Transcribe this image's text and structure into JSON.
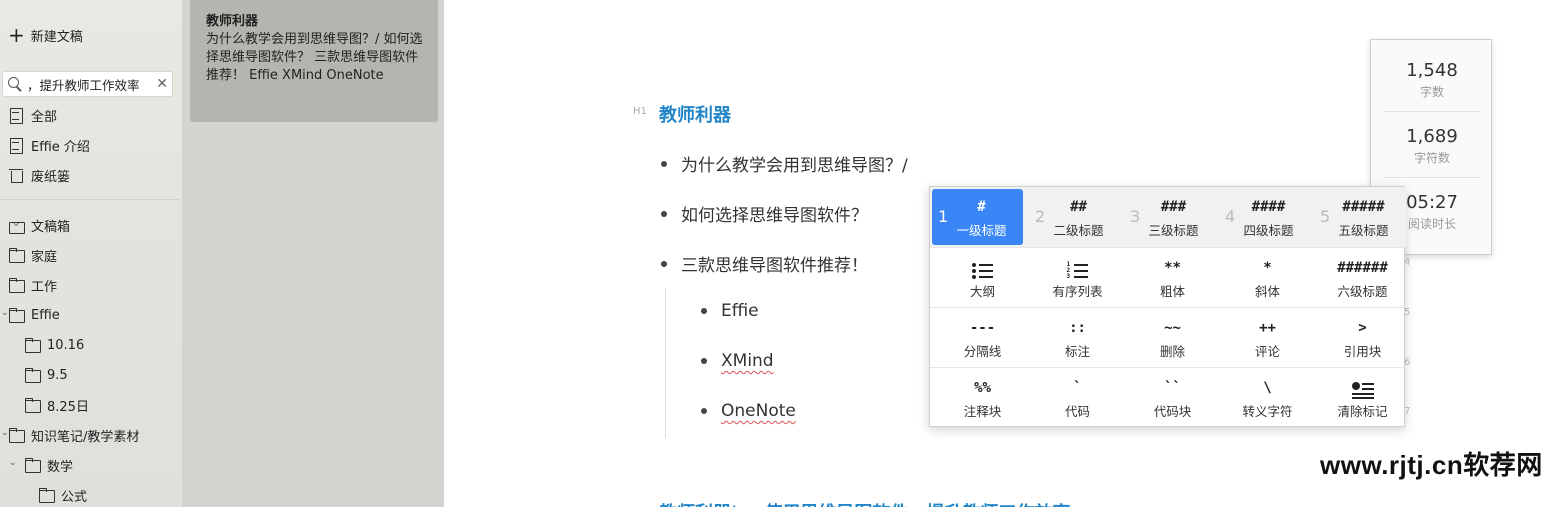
{
  "sidebar": {
    "new_doc_label": "新建文稿",
    "search": {
      "value": "，提升教师工作效率"
    },
    "items": [
      {
        "label": "全部"
      },
      {
        "label": "Effie 介绍"
      },
      {
        "label": "废纸篓"
      },
      {
        "label": "文稿箱"
      },
      {
        "label": "家庭"
      },
      {
        "label": "工作"
      },
      {
        "label": "Effie"
      },
      {
        "label": "10.16"
      },
      {
        "label": "9.5"
      },
      {
        "label": "8.25日"
      },
      {
        "label": "知识笔记/教学素材"
      },
      {
        "label": "数学"
      },
      {
        "label": "公式"
      }
    ]
  },
  "doclist": {
    "selected": {
      "title": "教师利器",
      "preview": "为什么教学会用到思维导图？/ 如何选择思维导图软件？  三款思维导图软件推荐！  Effie XMind OneNote"
    }
  },
  "editor": {
    "heading_tag": "H1",
    "heading": "教师利器",
    "bullets": [
      "为什么教学会用到思维导图？/",
      "如何选择思维导图软件？",
      "三款思维导图软件推荐！"
    ],
    "sub_bullets": [
      "Effie",
      "XMind",
      "OneNote"
    ],
    "line_numbers": [
      "4",
      "5",
      "6",
      "7"
    ],
    "next_heading": "教师利器|... 使用思维导图软件，提升教师工作效率"
  },
  "stats": [
    {
      "value": "1,548",
      "label": "字数"
    },
    {
      "value": "1,689",
      "label": "字符数"
    },
    {
      "value": "05:27",
      "label": "阅读时长"
    }
  ],
  "palette": {
    "rows": [
      [
        {
          "idx": "1",
          "sym": "#",
          "label": "一级标题"
        },
        {
          "idx": "2",
          "sym": "##",
          "label": "二级标题"
        },
        {
          "idx": "3",
          "sym": "###",
          "label": "三级标题"
        },
        {
          "idx": "4",
          "sym": "####",
          "label": "四级标题"
        },
        {
          "idx": "5",
          "sym": "#####",
          "label": "五级标题"
        }
      ],
      [
        {
          "sym": "",
          "icon": "outline-icon",
          "label": "大纲"
        },
        {
          "sym": "",
          "icon": "ordered-list-icon",
          "label": "有序列表"
        },
        {
          "sym": "**",
          "label": "粗体"
        },
        {
          "sym": "*",
          "label": "斜体"
        },
        {
          "sym": "######",
          "label": "六级标题"
        }
      ],
      [
        {
          "sym": "---",
          "label": "分隔线"
        },
        {
          "sym": "::",
          "label": "标注"
        },
        {
          "sym": "~~",
          "label": "删除"
        },
        {
          "sym": "++",
          "label": "评论"
        },
        {
          "sym": ">",
          "label": "引用块"
        }
      ],
      [
        {
          "sym": "%%",
          "label": "注释块"
        },
        {
          "sym": "`",
          "label": "代码"
        },
        {
          "sym": "``",
          "label": "代码块"
        },
        {
          "sym": "\\",
          "label": "转义字符"
        },
        {
          "sym": "",
          "icon": "clear-format-icon",
          "label": "清除标记"
        }
      ]
    ],
    "active_color": "#3b86f6"
  },
  "watermark": "www.rjtj.cn软荐网",
  "colors": {
    "heading": "#2185c8",
    "sidebar_bg": "#e6e6e1",
    "card_bg": "#b4b5af"
  }
}
